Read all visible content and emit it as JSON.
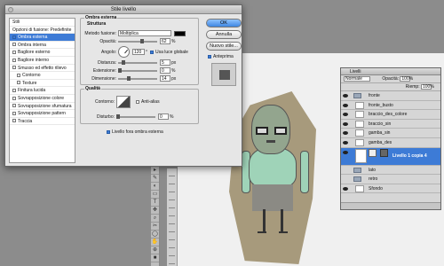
{
  "dialog": {
    "title": "Stile livello",
    "styles": [
      {
        "label": "Stili",
        "checkbox": false,
        "selected": false,
        "indent": false
      },
      {
        "label": "Opzioni di fusione: Predefinite",
        "checkbox": false,
        "selected": false,
        "indent": false
      },
      {
        "label": "Ombra esterna",
        "checkbox": true,
        "checked": true,
        "selected": true,
        "indent": false
      },
      {
        "label": "Ombra interna",
        "checkbox": true,
        "checked": false,
        "selected": false,
        "indent": false
      },
      {
        "label": "Bagliore esterno",
        "checkbox": true,
        "checked": false,
        "selected": false,
        "indent": false
      },
      {
        "label": "Bagliore interno",
        "checkbox": true,
        "checked": false,
        "selected": false,
        "indent": false
      },
      {
        "label": "Smusso ed effetto rilievo",
        "checkbox": true,
        "checked": false,
        "selected": false,
        "indent": false
      },
      {
        "label": "Contorno",
        "checkbox": true,
        "checked": false,
        "selected": false,
        "indent": true
      },
      {
        "label": "Texture",
        "checkbox": true,
        "checked": false,
        "selected": false,
        "indent": true
      },
      {
        "label": "Finitura lucida",
        "checkbox": true,
        "checked": false,
        "selected": false,
        "indent": false
      },
      {
        "label": "Sovrapposizione colore",
        "checkbox": true,
        "checked": false,
        "selected": false,
        "indent": false
      },
      {
        "label": "Sovrapposizione sfumatura",
        "checkbox": true,
        "checked": false,
        "selected": false,
        "indent": false
      },
      {
        "label": "Sovrapposizione pattern",
        "checkbox": true,
        "checked": false,
        "selected": false,
        "indent": false
      },
      {
        "label": "Traccia",
        "checkbox": true,
        "checked": false,
        "selected": false,
        "indent": false
      }
    ],
    "section_title": "Ombra esterna",
    "structure": {
      "title": "Struttura",
      "blend_label": "Metodo fusione:",
      "blend_value": "Moltiplica",
      "shadow_color": "#000000",
      "opacity_label": "Opacità:",
      "opacity_value": "62",
      "opacity_unit": "%",
      "opacity_level": 0.62,
      "angle_label": "Angolo:",
      "angle_value": "120",
      "angle_unit": "°",
      "global_light_label": "Usa luce globale",
      "distance_label": "Distanza:",
      "distance_value": "5",
      "size_label": "Estensione:",
      "size_value": "0",
      "dimension_label": "Dimensione:",
      "dimension_value": "14",
      "px_unit": "px",
      "percent_unit": "%"
    },
    "quality": {
      "title": "Qualità",
      "contour_label": "Contorno:",
      "antialias_label": "Anti-alias",
      "noise_label": "Disturbo:",
      "noise_value": "0",
      "knockout_label": "Livello fora ombra esterna"
    },
    "buttons": {
      "ok": "OK",
      "cancel": "Annulla",
      "new_style": "Nuovo stile...",
      "preview": "Anteprima"
    }
  },
  "layers_panel": {
    "title": "Livelli",
    "blend_mode": "Normale",
    "opacity_label": "Opacità:",
    "opacity_value": "100%",
    "fill_label": "Riemp:",
    "fill_value": "100%",
    "layers": [
      {
        "name": "fronte",
        "type": "group",
        "visible": true
      },
      {
        "name": "fronte_busto",
        "type": "layer",
        "visible": true
      },
      {
        "name": "braccio_des_colore",
        "type": "layer",
        "visible": true
      },
      {
        "name": "braccio_sin",
        "type": "layer",
        "visible": true
      },
      {
        "name": "gamba_sin",
        "type": "layer",
        "visible": true
      },
      {
        "name": "gamba_des",
        "type": "layer",
        "visible": true
      },
      {
        "name": "Livello 1 copia 4",
        "type": "layer",
        "visible": true,
        "selected": true
      },
      {
        "name": "lato",
        "type": "group",
        "visible": false
      },
      {
        "name": "retro",
        "type": "group",
        "visible": false
      },
      {
        "name": "Sfondo",
        "type": "layer",
        "visible": true
      }
    ]
  }
}
